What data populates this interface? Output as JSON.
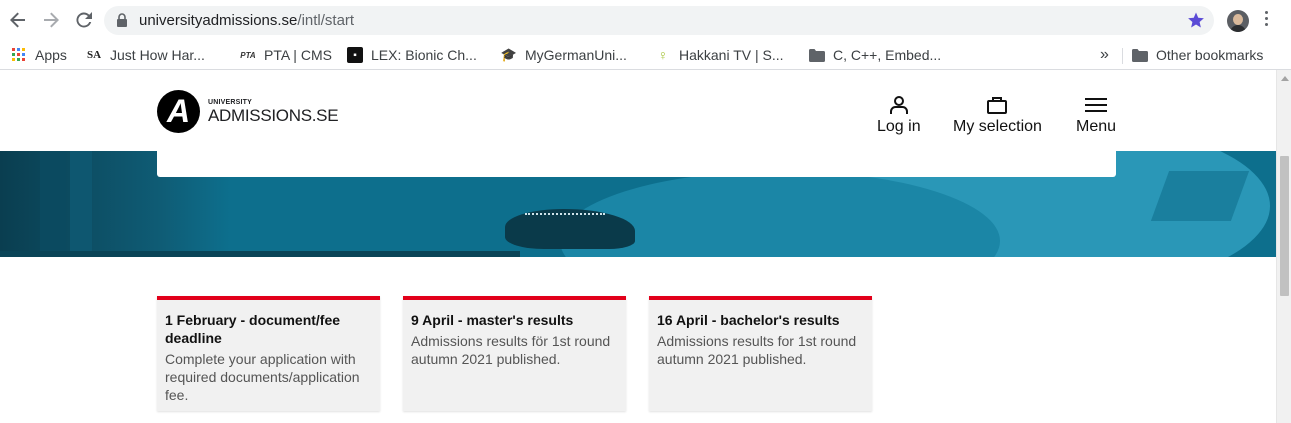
{
  "browser": {
    "url_host": "universityadmissions.se",
    "url_path": "/intl/start",
    "bookmarks": [
      {
        "label": "Apps",
        "icon": "apps-grid-icon"
      },
      {
        "label": "Just How Har...",
        "icon": "sa-favicon"
      },
      {
        "label": "PTA | CMS",
        "icon": "pta-favicon"
      },
      {
        "label": "LEX: Bionic Ch...",
        "icon": "lex-favicon"
      },
      {
        "label": "MyGermanUni...",
        "icon": "graduate-favicon"
      },
      {
        "label": "Hakkani TV | S...",
        "icon": "hakkani-favicon"
      },
      {
        "label": "C, C++, Embed...",
        "icon": "folder-icon"
      }
    ],
    "overflow_label": "»",
    "other_bookmarks": "Other bookmarks"
  },
  "site": {
    "logo_small": "UNIVERSITY",
    "logo_big": "ADMISSIONS.SE",
    "logo_mark": "A",
    "nav": {
      "login": "Log in",
      "selection": "My selection",
      "menu": "Menu"
    }
  },
  "cards": [
    {
      "title": "1 February - document/fee deadline",
      "text": "Complete your application with required documents/application fee."
    },
    {
      "title": "9 April - master's results",
      "text": "Admissions results för 1st round autumn 2021 published."
    },
    {
      "title": "16 April - bachelor's results",
      "text": "Admissions results for 1st round autumn 2021 published."
    }
  ],
  "colors": {
    "accent_red": "#e2001a",
    "hero_blue": "#0d6f8d",
    "star_blue": "#5b4bd6"
  }
}
